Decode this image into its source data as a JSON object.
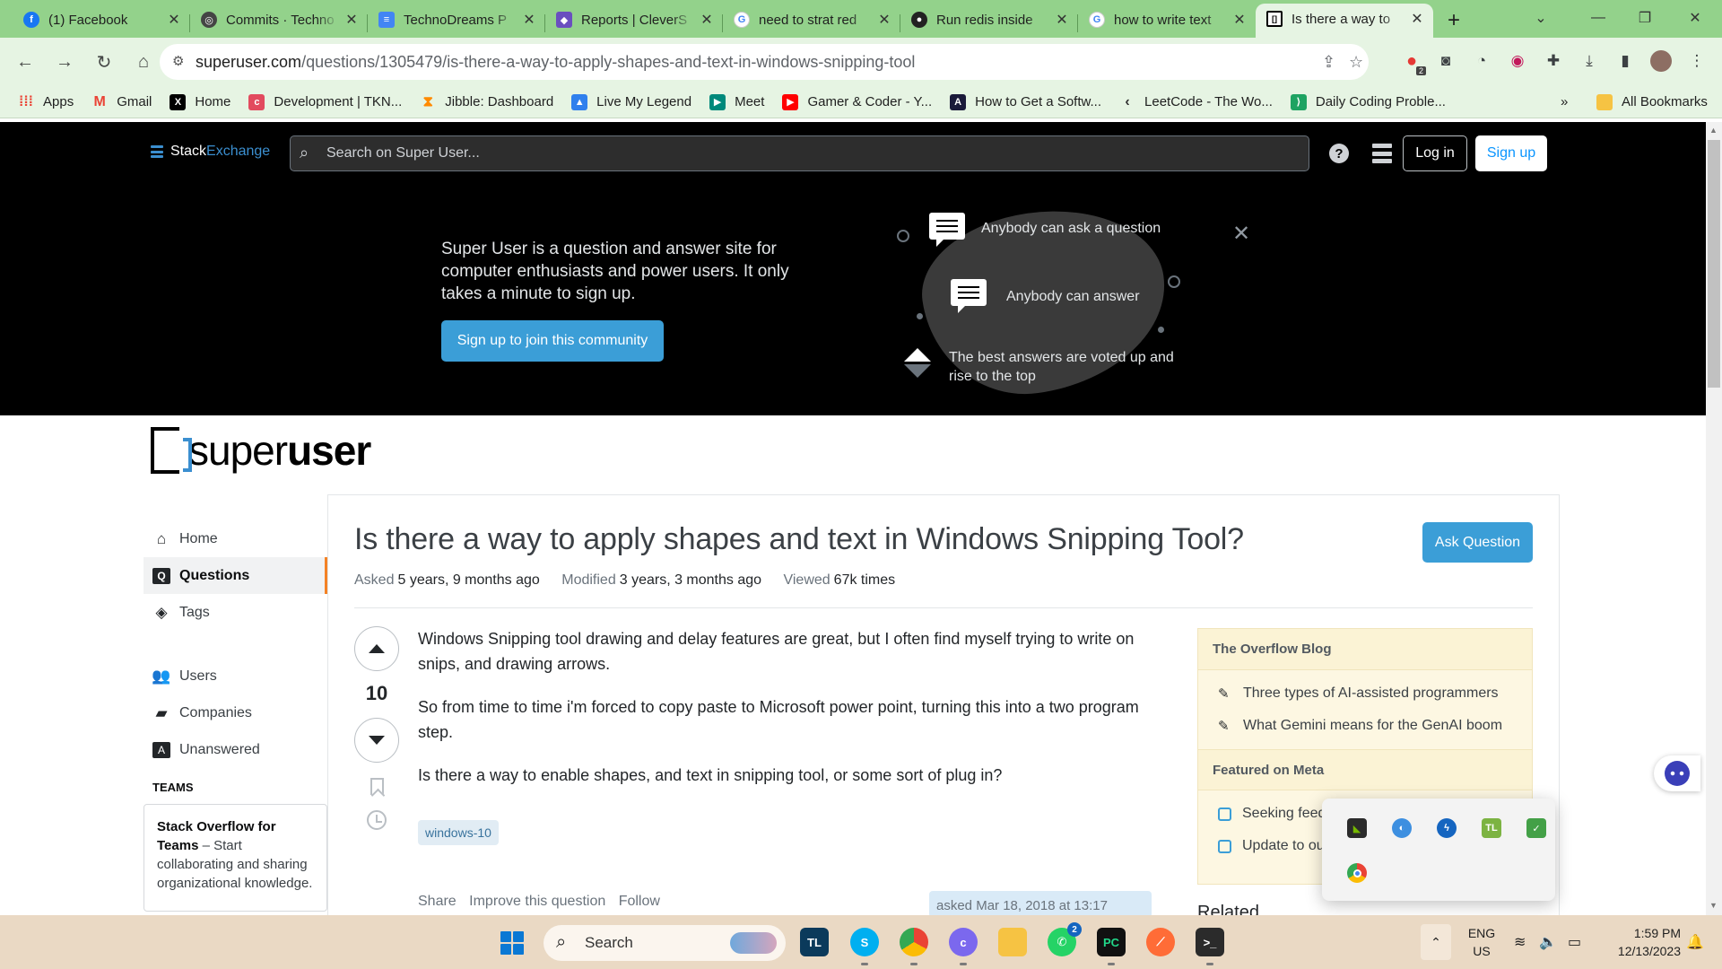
{
  "browser": {
    "tabs": [
      {
        "title": "(1) Facebook",
        "icon": "facebook-icon",
        "color": "#1877f2",
        "glyph": "f"
      },
      {
        "title": "Commits · Techno",
        "icon": "github-icon",
        "color": "#444444",
        "glyph": "◎"
      },
      {
        "title": "TechnoDreams P",
        "icon": "docs-icon",
        "color": "#4285f4",
        "glyph": "≡"
      },
      {
        "title": "Reports | CleverS",
        "icon": "reports-icon",
        "color": "#6a4fbf",
        "glyph": "◆"
      },
      {
        "title": "need to strat red",
        "icon": "google-icon",
        "color": "#ffffff",
        "glyph": "G"
      },
      {
        "title": "Run redis inside",
        "icon": "github-icon",
        "color": "#222222",
        "glyph": "●"
      },
      {
        "title": "how to write text",
        "icon": "google-icon",
        "color": "#ffffff",
        "glyph": "G"
      },
      {
        "title": "Is there a way to",
        "icon": "superuser-icon",
        "color": "#ffffff",
        "glyph": "[]",
        "active": true
      }
    ],
    "url_host": "superuser.com",
    "url_path": "/questions/1305479/is-there-a-way-to-apply-shapes-and-text-in-windows-snipping-tool",
    "extension_badge": "2",
    "bookmarks": [
      {
        "label": "Apps",
        "icon": "apps-grid-icon",
        "color": "#ea4335"
      },
      {
        "label": "Gmail",
        "icon": "gmail-icon",
        "color": "#ea4335"
      },
      {
        "label": "Home",
        "icon": "x-icon",
        "color": "#000000"
      },
      {
        "label": "Development | TKN...",
        "icon": "clickup-icon",
        "color": "#e24a5e"
      },
      {
        "label": "Jibble: Dashboard",
        "icon": "jibble-icon",
        "color": "#ff8a00"
      },
      {
        "label": "Live My Legend",
        "icon": "legend-icon",
        "color": "#2f80ed"
      },
      {
        "label": "Meet",
        "icon": "meet-icon",
        "color": "#00897b"
      },
      {
        "label": "Gamer & Coder - Y...",
        "icon": "youtube-icon",
        "color": "#ff0000"
      },
      {
        "label": "How to Get a Softw...",
        "icon": "bookmark-a-icon",
        "color": "#1a1a3a"
      },
      {
        "label": "LeetCode - The Wo...",
        "icon": "leetcode-icon",
        "color": "#ffa116"
      },
      {
        "label": "Daily Coding Proble...",
        "icon": "daily-coding-icon",
        "color": "#1ea362"
      }
    ],
    "overflow": "»",
    "all_bookmarks": "All Bookmarks"
  },
  "se": {
    "brand_stack": "Stack",
    "brand_exchange": "Exchange",
    "search_placeholder": "Search on Super User...",
    "login": "Log in",
    "signup": "Sign up"
  },
  "hero": {
    "text": "Super User is a question and answer site for computer enthusiasts and power users. It only takes a minute to sign up.",
    "cta": "Sign up to join this community",
    "item1": "Anybody can ask a question",
    "item2": "Anybody can answer",
    "item3": "The best answers are voted up and rise to the top"
  },
  "site": {
    "logo_light": "super",
    "logo_bold": "user"
  },
  "nav": {
    "home": "Home",
    "questions": "Questions",
    "tags": "Tags",
    "users": "Users",
    "companies": "Companies",
    "unanswered": "Unanswered",
    "teams_heading": "TEAMS",
    "teams_title": "Stack Overflow for Teams",
    "teams_text": " – Start collaborating and sharing organizational knowledge."
  },
  "question": {
    "title": "Is there a way to apply shapes and text in Windows Snipping Tool?",
    "ask_button": "Ask Question",
    "asked_label": "Asked",
    "asked_value": "5 years, 9 months ago",
    "modified_label": "Modified",
    "modified_value": "3 years, 3 months ago",
    "viewed_label": "Viewed",
    "viewed_value": "67k times",
    "votes": "10",
    "body": [
      "Windows Snipping tool drawing and delay features are great, but I often find myself trying to write on snips, and drawing arrows.",
      "So from time to time i'm forced to copy paste to Microsoft power point, turning this into a two program step.",
      "Is there a way to enable shapes, and text in snipping tool, or some sort of plug in?"
    ],
    "tag": "windows-10",
    "share": "Share",
    "improve": "Improve this question",
    "follow": "Follow",
    "asked_at": "asked Mar 18, 2018 at 13:17"
  },
  "sidebar": {
    "blog_heading": "The Overflow Blog",
    "blog_items": [
      "Three types of AI-assisted programmers",
      "What Gemini means for the GenAI boom"
    ],
    "meta_heading": "Featured on Meta",
    "meta_items": [
      "Seeking feed",
      "Update to ou"
    ],
    "related": "Related"
  },
  "taskbar": {
    "search": "Search",
    "lang_1": "ENG",
    "lang_2": "US",
    "time": "1:59 PM",
    "date": "12/13/2023",
    "whatsapp_badge": "2"
  }
}
